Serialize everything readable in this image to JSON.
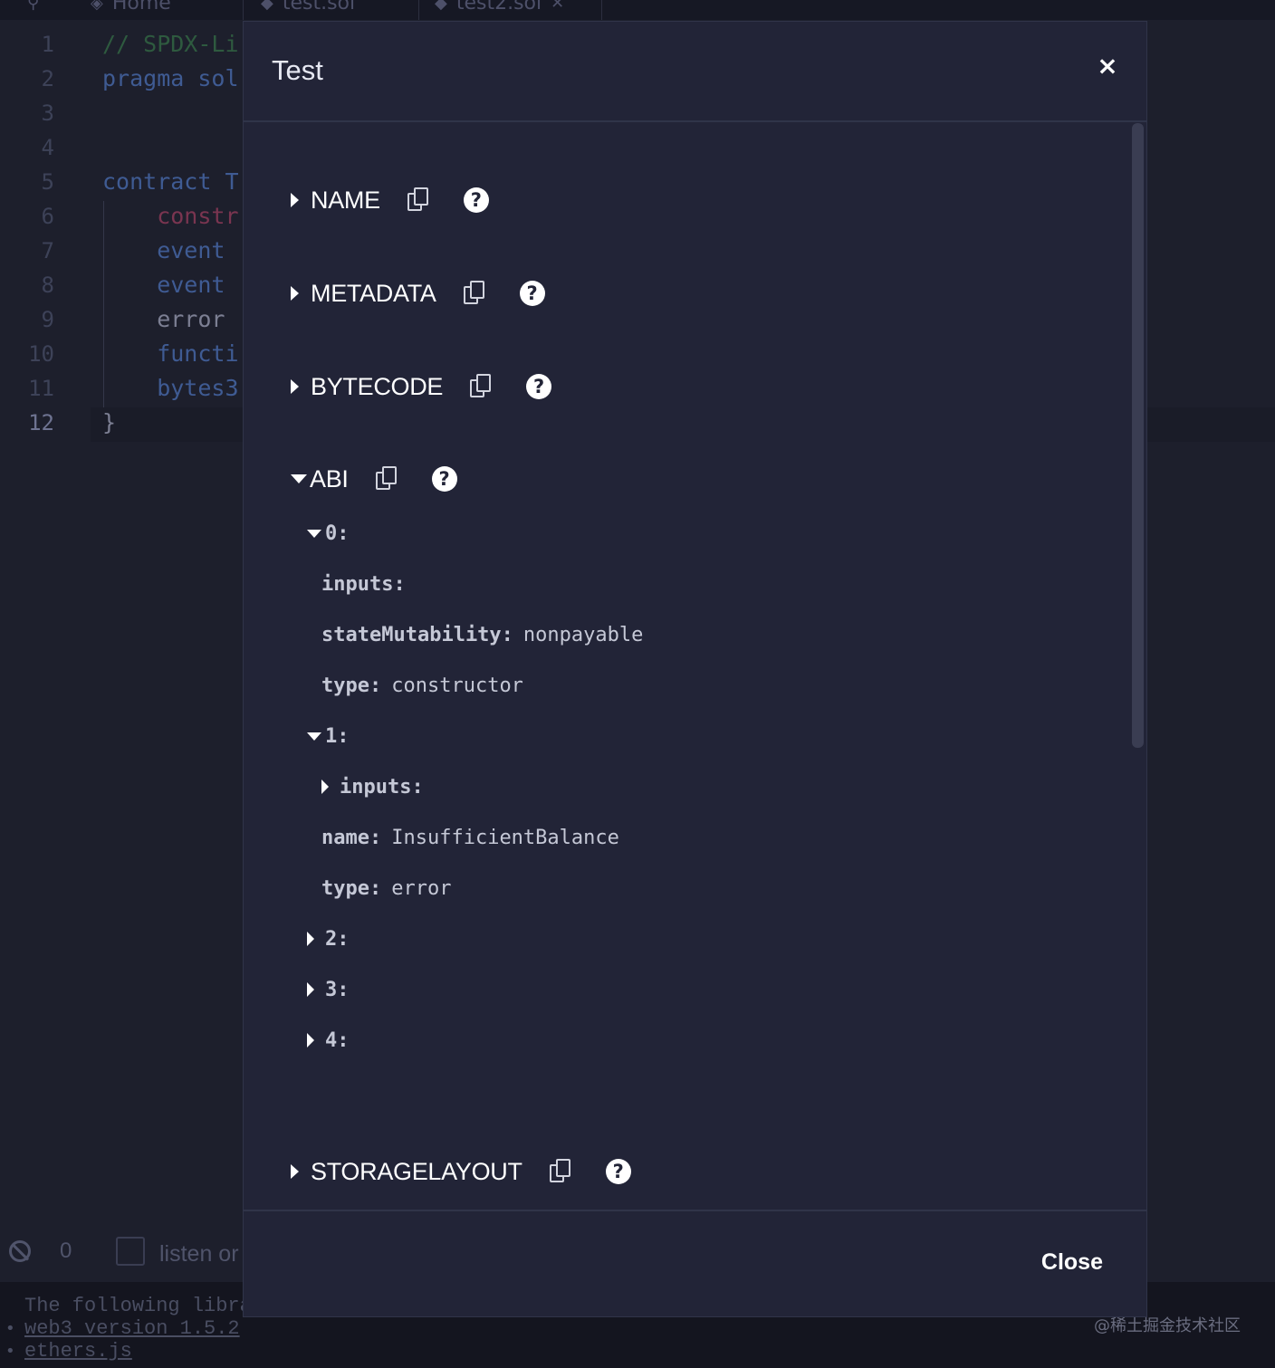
{
  "editor": {
    "tabs": [
      {
        "label": "Home"
      },
      {
        "label": "test.sol"
      },
      {
        "label": "test2.sol"
      }
    ],
    "line_numbers": [
      "1",
      "2",
      "3",
      "4",
      "5",
      "6",
      "7",
      "8",
      "9",
      "10",
      "11",
      "12"
    ],
    "code_lines": [
      "// SPDX-Li",
      "pragma sol",
      "",
      "",
      "contract T",
      "    constr",
      "    event ",
      "    event ",
      "    error ",
      "    functi",
      "    bytes3",
      "}"
    ]
  },
  "terminal": {
    "count": "0",
    "listen_label": "listen or",
    "lines": [
      "The following librar",
      "web3 version 1.5.2",
      "ethers.js"
    ]
  },
  "watermark": "@稀土掘金技术社区",
  "modal": {
    "title": "Test",
    "close_icon": "×",
    "close_button": "Close",
    "sections": {
      "name": "NAME",
      "metadata": "METADATA",
      "bytecode": "BYTECODE",
      "abi": "ABI",
      "storagelayout": "STORAGELAYOUT"
    },
    "help_glyph": "?",
    "abi_tree": {
      "item0": {
        "key": "0:",
        "inputs": "inputs:",
        "stateMutability_key": "stateMutability:",
        "stateMutability_val": "nonpayable",
        "type_key": "type:",
        "type_val": "constructor"
      },
      "item1": {
        "key": "1:",
        "inputs": "inputs:",
        "name_key": "name:",
        "name_val": "InsufficientBalance",
        "type_key": "type:",
        "type_val": "error"
      },
      "item2": "2:",
      "item3": "3:",
      "item4": "4:"
    }
  },
  "colors": {
    "background": "#1d1f2c",
    "modal_bg": "#222437",
    "text": "#ffffff"
  }
}
